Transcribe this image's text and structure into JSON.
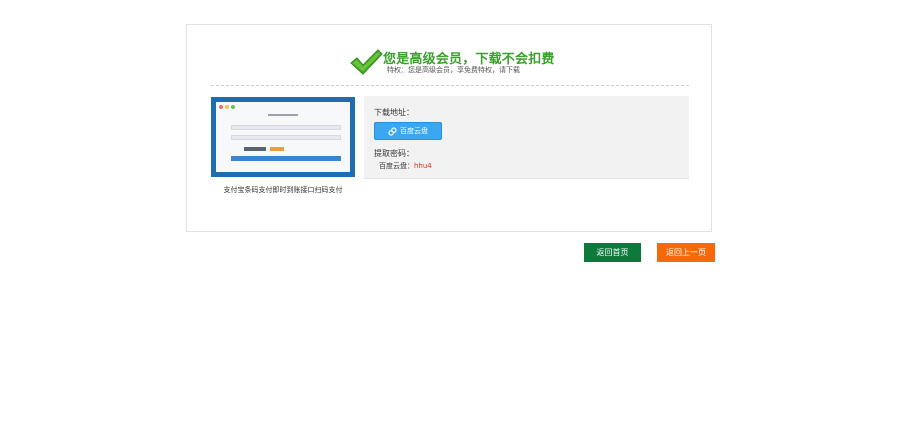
{
  "header": {
    "title": "您是高级会员，下载不会扣费",
    "subtitle": "特权：您是高级会员，享免费特权，请下载",
    "check_icon": "checkmark-icon",
    "title_color": "#3a9f2c"
  },
  "product": {
    "caption": "支付宝条码支付即时到账接口扫码支付",
    "thumbnail_icon": "payment-form-screenshot"
  },
  "download": {
    "address_label": "下载地址：",
    "pan_button_label": "百度云盘",
    "pan_icon": "cloud-link-icon",
    "extract_label": "提取密码：",
    "code_prefix": "百度云盘：",
    "code_value": "hhu4"
  },
  "actions": {
    "home_label": "返回首页",
    "back_label": "返回上一页",
    "home_color": "#0b7a3a",
    "back_color": "#f76809"
  }
}
